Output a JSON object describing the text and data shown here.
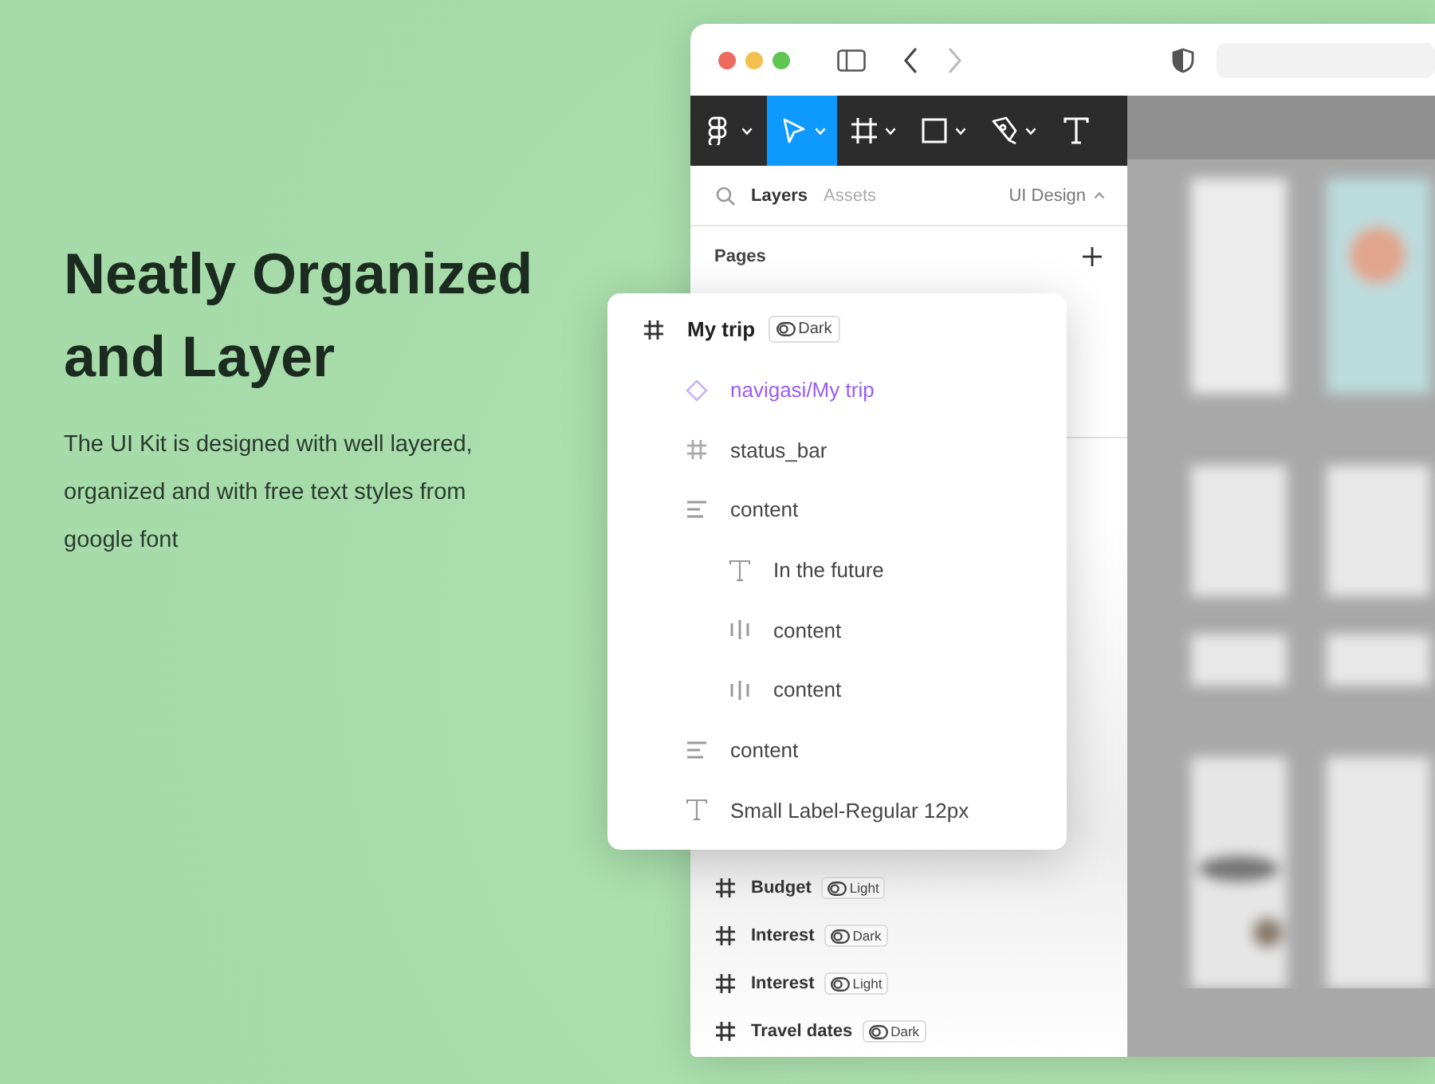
{
  "hero": {
    "title": "Neatly Organized and Layer",
    "description": "The UI Kit is designed with well layered, organized and with free text styles from google font"
  },
  "window": {
    "nav": {
      "back_disabled": false,
      "forward_disabled": true
    },
    "toolbar": [
      {
        "kind": "figma",
        "selected": false,
        "caret": true
      },
      {
        "kind": "move",
        "selected": true,
        "caret": true
      },
      {
        "kind": "frame",
        "selected": false,
        "caret": true
      },
      {
        "kind": "rectangle",
        "selected": false,
        "caret": true
      },
      {
        "kind": "pen",
        "selected": false,
        "caret": true
      },
      {
        "kind": "text",
        "selected": false,
        "caret": false
      }
    ],
    "panel": {
      "tabs": [
        {
          "label": "Layers",
          "selected": true
        },
        {
          "label": "Assets",
          "selected": false
        }
      ],
      "page_menu": "UI Design",
      "pages_heading": "Pages",
      "layers": [
        {
          "kind": "frame",
          "name": "Budget",
          "mode": "Light"
        },
        {
          "kind": "frame",
          "name": "Interest",
          "mode": "Dark"
        },
        {
          "kind": "frame",
          "name": "Interest",
          "mode": "Light"
        },
        {
          "kind": "frame",
          "name": "Travel dates",
          "mode": "Dark"
        }
      ]
    }
  },
  "layer_popup": {
    "kind": "frame",
    "name": "My trip",
    "mode": "Dark",
    "children": [
      {
        "kind": "component",
        "name": "navigasi/My trip"
      },
      {
        "kind": "frame",
        "name": "status_bar"
      },
      {
        "kind": "vstack",
        "name": "content",
        "children": [
          {
            "kind": "text",
            "name": "In the future"
          },
          {
            "kind": "hstack",
            "name": "content"
          },
          {
            "kind": "hstack",
            "name": "content"
          }
        ]
      },
      {
        "kind": "vstack",
        "name": "content"
      },
      {
        "kind": "text",
        "name": "Small Label-Regular 12px"
      }
    ]
  }
}
